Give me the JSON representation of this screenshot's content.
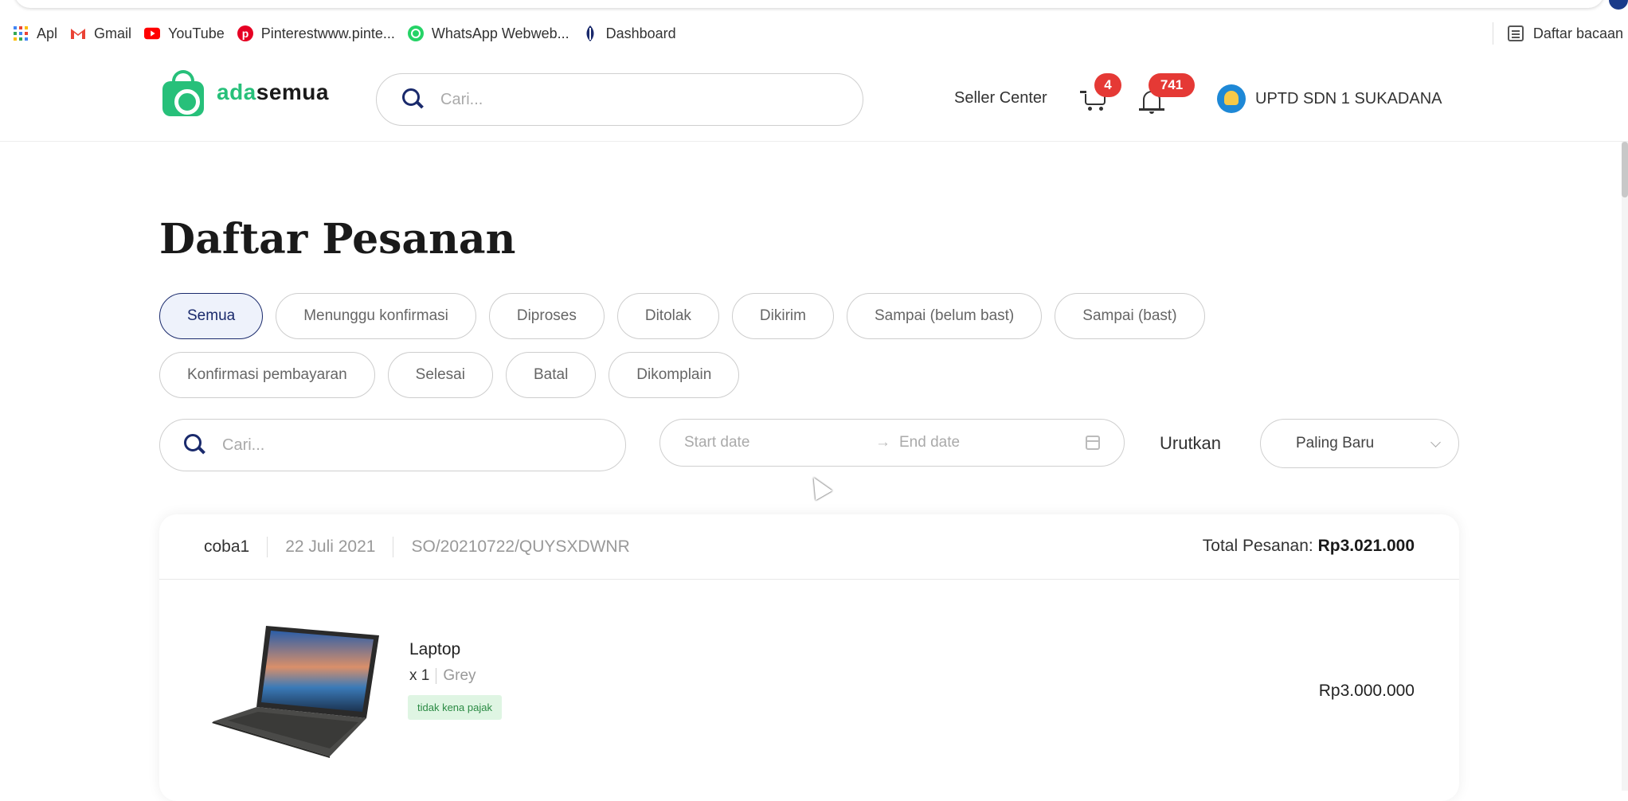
{
  "bookmarks": [
    {
      "label": "Apl",
      "icon": "apps-grid-icon"
    },
    {
      "label": "Gmail",
      "icon": "gmail-icon"
    },
    {
      "label": "YouTube",
      "icon": "youtube-icon"
    },
    {
      "label": "Pinterestwww.pinte...",
      "icon": "pinterest-icon"
    },
    {
      "label": "WhatsApp Webweb...",
      "icon": "whatsapp-icon"
    },
    {
      "label": "Dashboard",
      "icon": "dashboard-icon"
    }
  ],
  "reading_list": "Daftar bacaan",
  "header": {
    "logo_part1": "ada",
    "logo_part2": "semua",
    "search_placeholder": "Cari...",
    "seller_center": "Seller Center",
    "cart_count": "4",
    "notification_count": "741",
    "user_name": "UPTD SDN 1 SUKADANA"
  },
  "page": {
    "title": "Daftar Pesanan",
    "tabs": [
      "Semua",
      "Menunggu konfirmasi",
      "Diproses",
      "Ditolak",
      "Dikirim",
      "Sampai (belum bast)",
      "Sampai (bast)",
      "Konfirmasi pembayaran",
      "Selesai",
      "Batal",
      "Dikomplain"
    ],
    "active_tab": "Semua",
    "search_placeholder": "Cari...",
    "start_date_placeholder": "Start date",
    "date_arrow": "→",
    "end_date_placeholder": "End date",
    "sort_label": "Urutkan",
    "sort_value": "Paling Baru"
  },
  "order": {
    "store": "coba1",
    "date": "22 Juli 2021",
    "order_id": "SO/20210722/QUYSXDWNR",
    "total_label": "Total Pesanan:",
    "total_value": "Rp3.021.000",
    "item": {
      "name": "Laptop",
      "quantity": "x 1",
      "variant": "Grey",
      "tax_tag": "tidak kena pajak",
      "price": "Rp3.000.000"
    }
  },
  "colors": {
    "brand_green": "#27c07a",
    "accent_navy": "#1a2a6c",
    "badge_red": "#e53935",
    "tag_green_bg": "#dff5e3"
  }
}
